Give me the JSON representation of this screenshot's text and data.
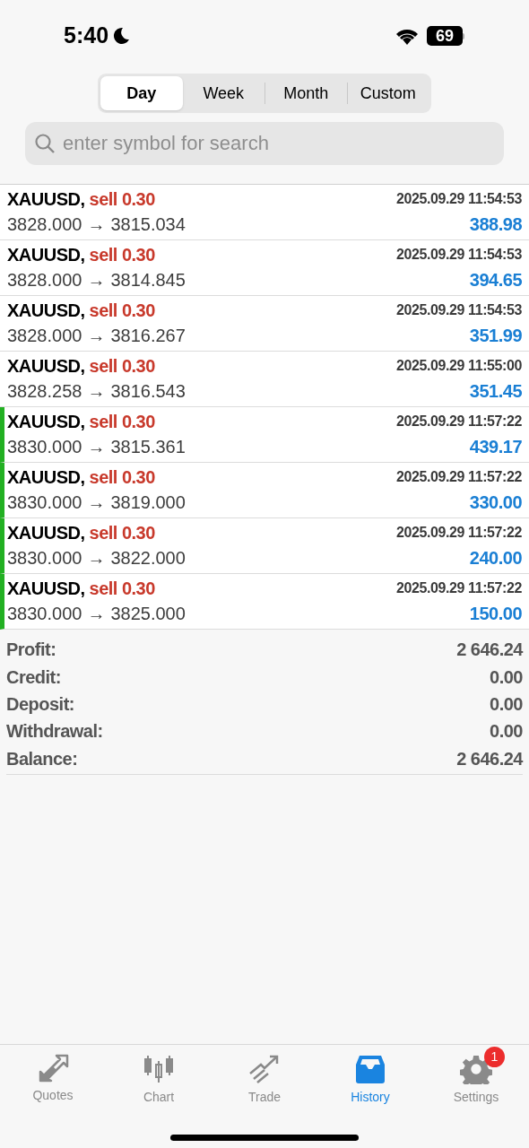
{
  "status_bar": {
    "time": "5:40",
    "battery": "69"
  },
  "tabs": [
    {
      "label": "Day",
      "selected": true
    },
    {
      "label": "Week",
      "selected": false
    },
    {
      "label": "Month",
      "selected": false
    },
    {
      "label": "Custom",
      "selected": false
    }
  ],
  "search": {
    "placeholder": "enter symbol for search"
  },
  "deals": [
    {
      "symbol": "XAUUSD,",
      "side": "sell 0.30",
      "time": "2025.09.29 11:54:53",
      "open": "3828.000",
      "arrow": "→",
      "close": "3815.034",
      "profit": "388.98",
      "marked": false
    },
    {
      "symbol": "XAUUSD,",
      "side": "sell 0.30",
      "time": "2025.09.29 11:54:53",
      "open": "3828.000",
      "arrow": "→",
      "close": "3814.845",
      "profit": "394.65",
      "marked": false
    },
    {
      "symbol": "XAUUSD,",
      "side": "sell 0.30",
      "time": "2025.09.29 11:54:53",
      "open": "3828.000",
      "arrow": "→",
      "close": "3816.267",
      "profit": "351.99",
      "marked": false
    },
    {
      "symbol": "XAUUSD,",
      "side": "sell 0.30",
      "time": "2025.09.29 11:55:00",
      "open": "3828.258",
      "arrow": "→",
      "close": "3816.543",
      "profit": "351.45",
      "marked": false
    },
    {
      "symbol": "XAUUSD,",
      "side": "sell 0.30",
      "time": "2025.09.29 11:57:22",
      "open": "3830.000",
      "arrow": "→",
      "close": "3815.361",
      "profit": "439.17",
      "marked": true
    },
    {
      "symbol": "XAUUSD,",
      "side": "sell 0.30",
      "time": "2025.09.29 11:57:22",
      "open": "3830.000",
      "arrow": "→",
      "close": "3819.000",
      "profit": "330.00",
      "marked": true
    },
    {
      "symbol": "XAUUSD,",
      "side": "sell 0.30",
      "time": "2025.09.29 11:57:22",
      "open": "3830.000",
      "arrow": "→",
      "close": "3822.000",
      "profit": "240.00",
      "marked": true
    },
    {
      "symbol": "XAUUSD,",
      "side": "sell 0.30",
      "time": "2025.09.29 11:57:22",
      "open": "3830.000",
      "arrow": "→",
      "close": "3825.000",
      "profit": "150.00",
      "marked": true
    }
  ],
  "summary": [
    {
      "label": "Profit:",
      "value": "2 646.24"
    },
    {
      "label": "Credit:",
      "value": "0.00"
    },
    {
      "label": "Deposit:",
      "value": "0.00"
    },
    {
      "label": "Withdrawal:",
      "value": "0.00"
    },
    {
      "label": "Balance:",
      "value": "2 646.24"
    }
  ],
  "tab_bar": [
    {
      "kind": "quotes",
      "label": "Quotes",
      "selected": false
    },
    {
      "kind": "chart",
      "label": "Chart",
      "selected": false
    },
    {
      "kind": "trade",
      "label": "Trade",
      "selected": false
    },
    {
      "kind": "history",
      "label": "History",
      "selected": true
    },
    {
      "kind": "settings",
      "label": "Settings",
      "selected": false,
      "badge": "1"
    }
  ]
}
